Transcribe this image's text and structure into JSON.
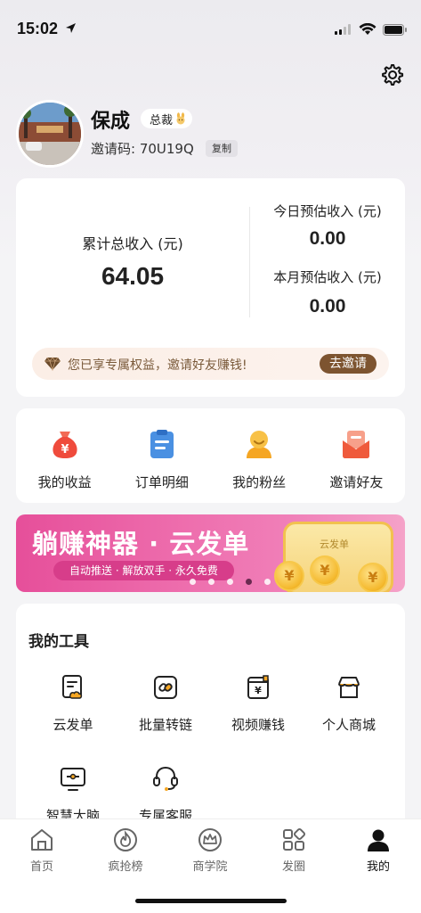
{
  "status_bar": {
    "time": "15:02"
  },
  "profile": {
    "name": "保成",
    "level_badge": "总裁",
    "invite_code_text": "邀请码: 70U19Q",
    "copy_label": "复制"
  },
  "income": {
    "total_label": "累计总收入 (元)",
    "total_value": "64.05",
    "today_label": "今日预估收入 (元)",
    "today_value": "0.00",
    "month_label": "本月预估收入 (元)",
    "month_value": "0.00",
    "benefit_text": "您已享专属权益，邀请好友赚钱!",
    "invite_button": "去邀请"
  },
  "quick_actions": [
    {
      "label": "我的收益",
      "icon": "money-bag-icon"
    },
    {
      "label": "订单明细",
      "icon": "clipboard-icon"
    },
    {
      "label": "我的粉丝",
      "icon": "fans-icon"
    },
    {
      "label": "邀请好友",
      "icon": "invite-envelope-icon"
    }
  ],
  "banner": {
    "title": "躺赚神器 · 云发单",
    "subtitle": "自动推送 · 解放双手 · 永久免费",
    "card_title": "云发单",
    "coin_symbol": "¥"
  },
  "tools": {
    "title": "我的工具",
    "items": [
      {
        "label": "云发单",
        "icon": "cloud-doc-icon"
      },
      {
        "label": "批量转链",
        "icon": "link-icon"
      },
      {
        "label": "视频赚钱",
        "icon": "video-money-icon"
      },
      {
        "label": "个人商城",
        "icon": "shop-icon"
      },
      {
        "label": "智慧大脑",
        "icon": "monitor-icon"
      },
      {
        "label": "专属客服",
        "icon": "headset-icon"
      }
    ]
  },
  "tabbar": [
    {
      "label": "首页",
      "icon": "home-icon"
    },
    {
      "label": "疯抢榜",
      "icon": "fire-icon"
    },
    {
      "label": "商学院",
      "icon": "crown-icon"
    },
    {
      "label": "发圈",
      "icon": "grid-icon"
    },
    {
      "label": "我的",
      "icon": "user-icon"
    }
  ],
  "colors": {
    "accent_brown": "#7d5430",
    "banner_pink": "#e64f9a",
    "quick_red": "#ef4b3c",
    "quick_blue": "#4a90e2",
    "quick_orange": "#f5a623"
  }
}
